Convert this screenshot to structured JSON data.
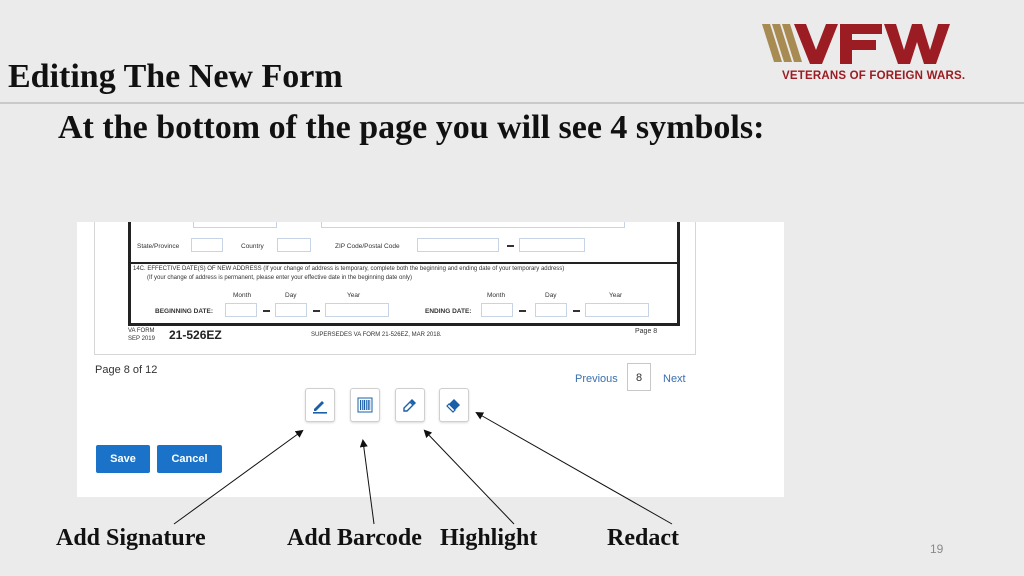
{
  "slide": {
    "title": "Editing The New Form",
    "subtitle": "At the bottom of the page you will see 4 symbols:",
    "page_number": "19"
  },
  "logo": {
    "letters": "VFW",
    "tagline": "VETERANS OF FOREIGN WARS.",
    "color": "#9b1c22",
    "stripe_color": "#a88b52"
  },
  "form": {
    "state_label": "State/Province",
    "country_label": "Country",
    "zip_label": "ZIP Code/Postal Code",
    "section_14c": "14C. EFFECTIVE DATE(S) OF NEW ADDRESS (If your change of address is temporary, complete both the beginning and ending date of your temporary address)",
    "section_14c_line2": "(If your change of address is permanent, please enter your effective date in the beginning date only)",
    "month": "Month",
    "day": "Day",
    "year": "Year",
    "beginning_date": "BEGINNING DATE:",
    "ending_date": "ENDING DATE:",
    "va_form": "VA FORM",
    "form_date": "SEP 2019",
    "form_number": "21-526EZ",
    "supersedes": "SUPERSEDES VA FORM 21-526EZ, MAR 2018.",
    "form_page": "Page 8"
  },
  "viewer": {
    "page_of": "Page 8 of 12",
    "previous": "Previous",
    "current_page": "8",
    "next": "Next",
    "save": "Save",
    "cancel": "Cancel",
    "accent": "#1a73c8",
    "tools": [
      "pen-icon",
      "barcode-icon",
      "eyedropper-icon",
      "eraser-icon"
    ]
  },
  "labels": {
    "signature": "Add Signature",
    "barcode": "Add Barcode",
    "highlight": "Highlight",
    "redact": "Redact"
  }
}
